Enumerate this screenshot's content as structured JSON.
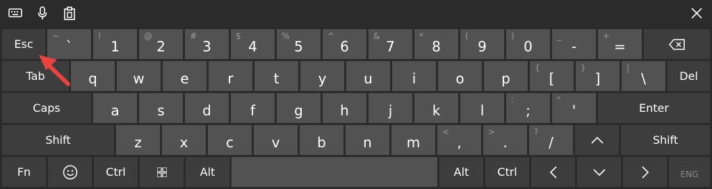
{
  "toolbar": {
    "icons": [
      "keyboard-icon",
      "microphone-icon",
      "clipboard-icon"
    ],
    "close_icon": "close-icon"
  },
  "keys": {
    "esc": "Esc",
    "tab": "Tab",
    "caps": "Caps",
    "shift_left": "Shift",
    "shift_right": "Shift",
    "fn": "Fn",
    "ctrl_left": "Ctrl",
    "alt_left": "Alt",
    "alt_right": "Alt",
    "ctrl_right": "Ctrl",
    "del": "Del",
    "enter": "Enter",
    "eng": "ENG",
    "row1": [
      {
        "sec": "~",
        "main": "`"
      },
      {
        "sec": "!",
        "main": "1"
      },
      {
        "sec": "@",
        "main": "2"
      },
      {
        "sec": "#",
        "main": "3"
      },
      {
        "sec": "$",
        "main": "4"
      },
      {
        "sec": "%",
        "main": "5"
      },
      {
        "sec": "^",
        "main": "6"
      },
      {
        "sec": "&",
        "main": "7"
      },
      {
        "sec": "*",
        "main": "8"
      },
      {
        "sec": "(",
        "main": "9"
      },
      {
        "sec": ")",
        "main": "0"
      },
      {
        "sec": "_",
        "main": "-"
      },
      {
        "sec": "+",
        "main": "="
      }
    ],
    "row2": [
      {
        "main": "q"
      },
      {
        "main": "w"
      },
      {
        "main": "e"
      },
      {
        "main": "r"
      },
      {
        "main": "t"
      },
      {
        "main": "y"
      },
      {
        "main": "u"
      },
      {
        "main": "i"
      },
      {
        "main": "o"
      },
      {
        "main": "p"
      },
      {
        "sec": "{",
        "main": "["
      },
      {
        "sec": "}",
        "main": "]"
      },
      {
        "sec": "|",
        "main": "\\"
      }
    ],
    "row3": [
      {
        "main": "a"
      },
      {
        "main": "s"
      },
      {
        "main": "d"
      },
      {
        "main": "f"
      },
      {
        "main": "g"
      },
      {
        "main": "h"
      },
      {
        "main": "j"
      },
      {
        "main": "k"
      },
      {
        "main": "l"
      },
      {
        "sec": ":",
        "main": ";"
      },
      {
        "sec": "\"",
        "main": "'"
      }
    ],
    "row4": [
      {
        "main": "z"
      },
      {
        "main": "x"
      },
      {
        "main": "c"
      },
      {
        "main": "v"
      },
      {
        "main": "b"
      },
      {
        "main": "n"
      },
      {
        "main": "m"
      },
      {
        "sec": "<",
        "main": ","
      },
      {
        "sec": ">",
        "main": "."
      },
      {
        "sec": "?",
        "main": "/"
      }
    ]
  },
  "annotation": {
    "arrow_color": "#e8433f"
  }
}
